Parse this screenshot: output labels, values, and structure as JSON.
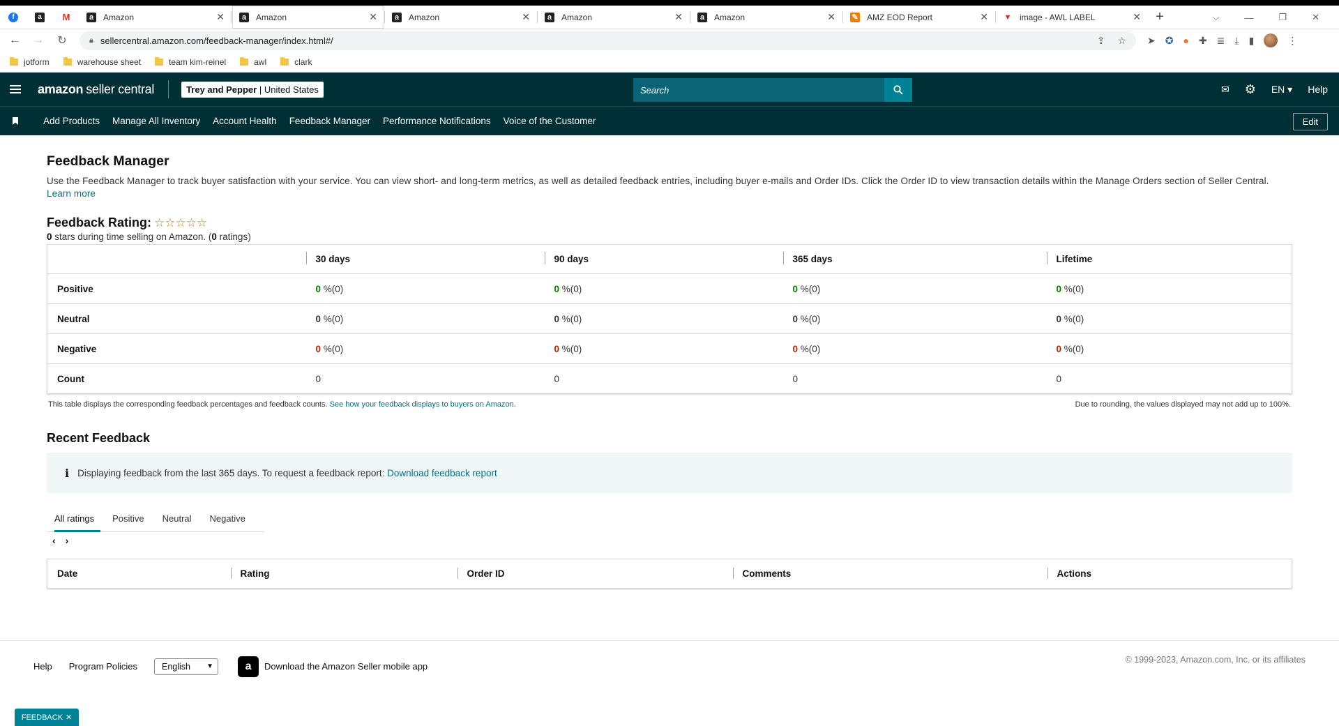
{
  "browser": {
    "tabs": [
      {
        "title": "Amazon",
        "active": false
      },
      {
        "title": "Amazon",
        "active": true
      },
      {
        "title": "Amazon",
        "active": false
      },
      {
        "title": "Amazon",
        "active": false
      },
      {
        "title": "Amazon",
        "active": false
      },
      {
        "title": "AMZ EOD Report",
        "active": false
      },
      {
        "title": "image - AWL LABEL",
        "active": false
      }
    ],
    "url": "sellercentral.amazon.com/feedback-manager/index.html#/",
    "bookmarks": [
      "jotform",
      "warehouse sheet",
      "team kim-reinel",
      "awl",
      "clark"
    ]
  },
  "header": {
    "logo_brand": "amazon",
    "logo_text": "seller central",
    "store_name": "Trey and Pepper",
    "store_region": "United States",
    "search_placeholder": "Search",
    "language": "EN",
    "help": "Help",
    "nav": [
      "Add Products",
      "Manage All Inventory",
      "Account Health",
      "Feedback Manager",
      "Performance Notifications",
      "Voice of the Customer"
    ],
    "edit": "Edit"
  },
  "page": {
    "title": "Feedback Manager",
    "intro": "Use the Feedback Manager to track buyer satisfaction with your service. You can view short- and long-term metrics, as well as detailed feedback entries, including buyer e-mails and Order IDs. Click the Order ID to view transaction details within the Manage Orders section of Seller Central.",
    "learn_more": "Learn more",
    "rating_title": "Feedback Rating:",
    "stars_glyph": "☆☆☆☆☆",
    "stars_value": "0",
    "stars_text": "stars during time selling on Amazon. (",
    "ratings_count": "0",
    "ratings_text": "ratings)",
    "table": {
      "columns": [
        "30 days",
        "90 days",
        "365 days",
        "Lifetime"
      ],
      "rows": [
        {
          "label": "Positive",
          "color": "#067d06",
          "cells": [
            [
              "0",
              "%(0)"
            ],
            [
              "0",
              "%(0)"
            ],
            [
              "0",
              "%(0)"
            ],
            [
              "0",
              "%(0)"
            ]
          ]
        },
        {
          "label": "Neutral",
          "color": "#333333",
          "cells": [
            [
              "0",
              "%(0)"
            ],
            [
              "0",
              "%(0)"
            ],
            [
              "0",
              "%(0)"
            ],
            [
              "0",
              "%(0)"
            ]
          ]
        },
        {
          "label": "Negative",
          "color": "#b12704",
          "cells": [
            [
              "0",
              "%(0)"
            ],
            [
              "0",
              "%(0)"
            ],
            [
              "0",
              "%(0)"
            ],
            [
              "0",
              "%(0)"
            ]
          ]
        },
        {
          "label": "Count",
          "cells": [
            "0",
            "0",
            "0",
            "0"
          ]
        }
      ],
      "note_left": "This table displays the corresponding feedback percentages and feedback counts.",
      "note_link": "See how your feedback displays to buyers on Amazon.",
      "note_right": "Due to rounding, the values displayed may not add up to 100%."
    },
    "recent_title": "Recent Feedback",
    "info_text": "Displaying feedback from the last 365 days. To request a feedback report:",
    "info_link": "Download feedback report",
    "tabs": [
      "All ratings",
      "Positive",
      "Neutral",
      "Negative"
    ],
    "recent_columns": [
      "Date",
      "Rating",
      "Order ID",
      "Comments",
      "Actions"
    ]
  },
  "footer": {
    "help": "Help",
    "policies": "Program Policies",
    "language": "English",
    "app_text": "Download the Amazon Seller mobile app",
    "copyright": "© 1999-2023, Amazon.com, Inc. or its affiliates"
  },
  "feedback_tab": "FEEDBACK"
}
